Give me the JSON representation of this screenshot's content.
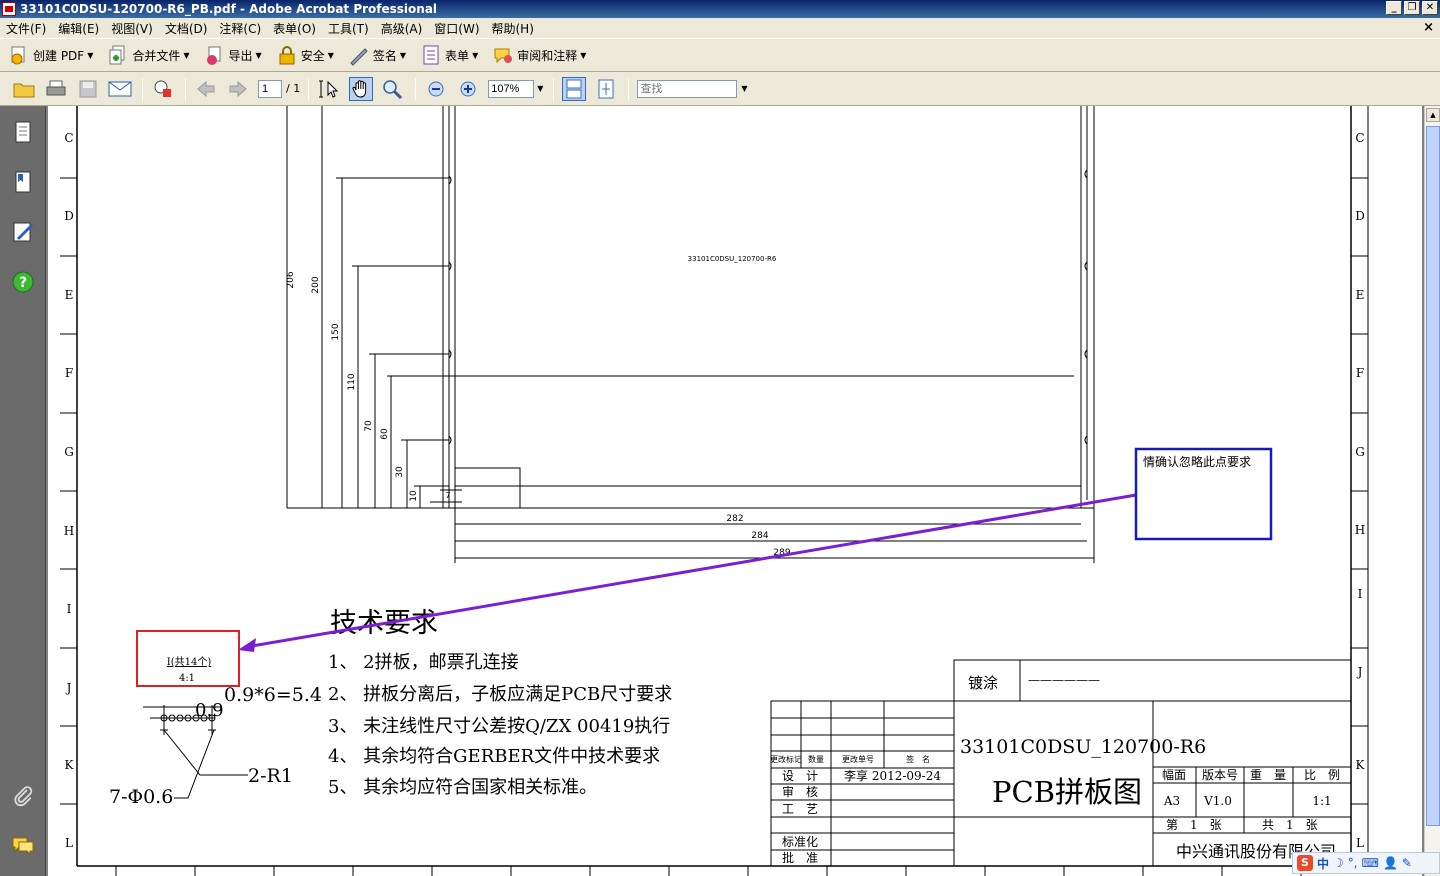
{
  "window": {
    "title": "33101C0DSU-120700-R6_PB.pdf - Adobe Acrobat Professional",
    "min": "_",
    "restore": "❐",
    "close": "✕",
    "doc_close": "×"
  },
  "menu": [
    "文件(F)",
    "编辑(E)",
    "视图(V)",
    "文档(D)",
    "注释(C)",
    "表单(O)",
    "工具(T)",
    "高级(A)",
    "窗口(W)",
    "帮助(H)"
  ],
  "toolbar1": {
    "create_pdf": "创建 PDF",
    "combine": "合并文件",
    "export": "导出",
    "secure": "安全",
    "sign": "签名",
    "forms": "表单",
    "review": "审阅和注释"
  },
  "toolbar2": {
    "page_current": "1",
    "page_total": "/ 1",
    "zoom": "107%",
    "find_placeholder": "查找"
  },
  "drawing": {
    "rows_left": [
      "C",
      "D",
      "E",
      "F",
      "G",
      "H",
      "I",
      "J",
      "K",
      "L"
    ],
    "rows_right": [
      "C",
      "D",
      "E",
      "F",
      "G",
      "H",
      "I",
      "J",
      "K",
      "L"
    ],
    "board_label": "33101C0DSU_120700-R6",
    "vdims": [
      "206",
      "200",
      "150",
      "110",
      "70",
      "60",
      "30",
      "10"
    ],
    "small_dim": "7",
    "hdims": [
      "282",
      "284",
      "289"
    ],
    "detail_label": "I(共14个)",
    "detail_scale": "4:1",
    "dim_pitch": "0.9*6=5.4",
    "dim_small": "0.9",
    "dim_r": "2-R1",
    "dim_holes": "7-Φ0.6",
    "tech_title": "技术要求",
    "tech_items": [
      "1、 2拼板，邮票孔连接",
      "2、 拼板分离后，子板应满足PCB尺寸要求",
      "3、 未注线性尺寸公差按Q/ZX 00419执行",
      "4、 其余均符合GERBER文件中技术要求",
      "5、 其余均应符合国家相关标准。"
    ],
    "tb_plating": "镀涂",
    "tb_plating_value": "——————",
    "tb_partno": "33101C0DSU_120700-R6",
    "tb_name": "PCB拼板图",
    "tb_rev_header": [
      "更改标记",
      "数量",
      "更改单号",
      "签　名"
    ],
    "tb_design": "设　计",
    "tb_design_value": "李享 2012-09-24",
    "tb_review": "审　核",
    "tb_process": "工　艺",
    "tb_std": "标准化",
    "tb_approve": "批　准",
    "tb_format": "幅面",
    "tb_version": "版本号",
    "tb_weight": "重　量",
    "tb_scale": "比　例",
    "tb_format_value": "A3",
    "tb_version_value": "V1.0",
    "tb_scale_value": "1:1",
    "tb_sheet": "第　1　张",
    "tb_total": "共　1　张",
    "tb_company": "中兴通讯股份有限公司"
  },
  "annotation": {
    "note_text": "情确认忽略此点要求"
  },
  "ime": {
    "s": "S",
    "mode": "中"
  },
  "colors": {
    "titlebar": "#0a246a",
    "annotation_box": "#1a1ab4",
    "annotation_arrow": "#7a1fd1",
    "detail_box": "#e02020"
  }
}
